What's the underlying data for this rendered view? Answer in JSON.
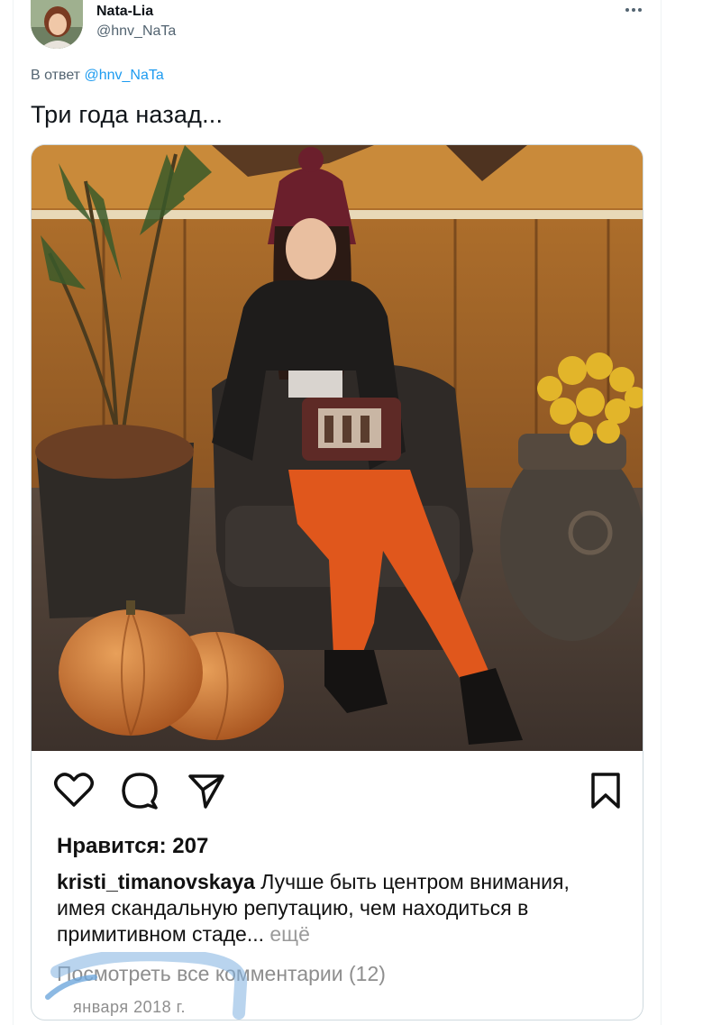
{
  "tweet": {
    "author_name": "Nata-Lia",
    "author_handle": "@hnv_NaTa",
    "reply_prefix": "В ответ",
    "reply_to": "@hnv_NaTa",
    "text": "Три года назад..."
  },
  "instagram": {
    "likes": "Нравится: 207",
    "username": "kristi_timanovskaya",
    "caption": " Лучше быть центром внимания, имея скандальную репутацию, чем находиться в примитивном стаде...",
    "more": " ещё",
    "comments": "Посмотреть все комментарии (12)",
    "date": "января 2018 г."
  },
  "icons": [
    "more-icon",
    "heart-icon",
    "comment-icon",
    "share-icon",
    "bookmark-icon"
  ],
  "colors": {
    "link": "#1d9bf0",
    "secondary_text": "#536471",
    "scribble": "#6fa8dc"
  }
}
